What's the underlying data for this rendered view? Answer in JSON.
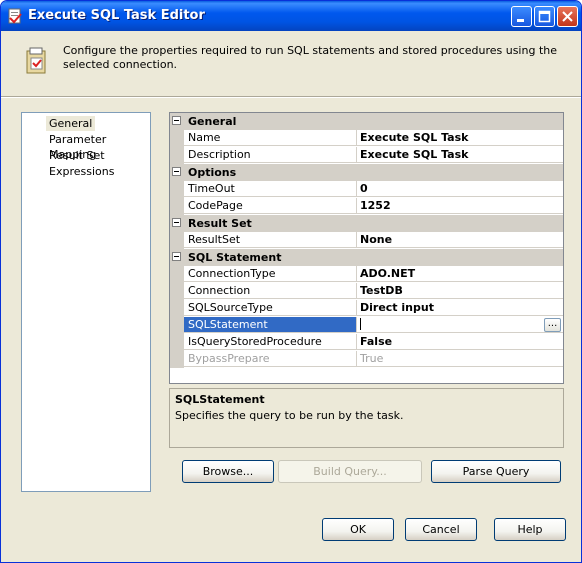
{
  "window": {
    "title": "Execute SQL Task Editor"
  },
  "header": {
    "text": "Configure the properties required to run SQL statements and stored procedures using the selected connection."
  },
  "nav": {
    "items": [
      {
        "label": "General",
        "selected": true
      },
      {
        "label": "Parameter Mapping",
        "selected": false
      },
      {
        "label": "Result Set",
        "selected": false
      },
      {
        "label": "Expressions",
        "selected": false
      }
    ]
  },
  "grid": {
    "categories": [
      {
        "label": "General",
        "props": [
          {
            "name": "Name",
            "value": "Execute SQL Task"
          },
          {
            "name": "Description",
            "value": "Execute SQL Task"
          }
        ]
      },
      {
        "label": "Options",
        "props": [
          {
            "name": "TimeOut",
            "value": "0"
          },
          {
            "name": "CodePage",
            "value": "1252"
          }
        ]
      },
      {
        "label": "Result Set",
        "props": [
          {
            "name": "ResultSet",
            "value": "None"
          }
        ]
      },
      {
        "label": "SQL Statement",
        "props": [
          {
            "name": "ConnectionType",
            "value": "ADO.NET"
          },
          {
            "name": "Connection",
            "value": "TestDB"
          },
          {
            "name": "SQLSourceType",
            "value": "Direct input"
          },
          {
            "name": "SQLStatement",
            "value": ""
          },
          {
            "name": "IsQueryStoredProcedure",
            "value": "False"
          },
          {
            "name": "BypassPrepare",
            "value": "True"
          }
        ]
      }
    ],
    "ellipsis": "..."
  },
  "description": {
    "title": "SQLStatement",
    "text": "Specifies the query to be run by the task."
  },
  "buttons": {
    "browse": "Browse...",
    "build_query": "Build Query...",
    "parse_query": "Parse Query",
    "ok": "OK",
    "cancel": "Cancel",
    "help": "Help"
  }
}
